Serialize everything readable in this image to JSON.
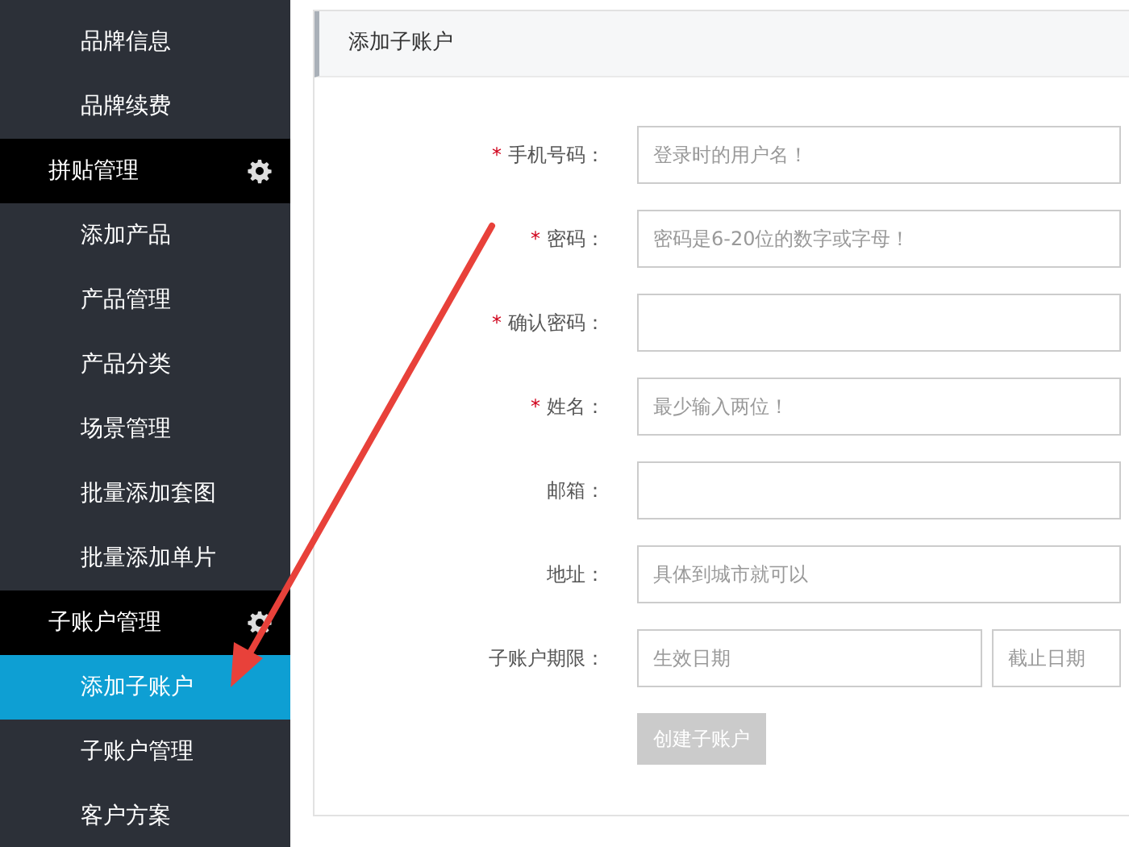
{
  "sidebar": {
    "items": [
      {
        "kind": "item",
        "label": "品牌信息",
        "selected": false
      },
      {
        "kind": "item",
        "label": "品牌续费",
        "selected": false
      },
      {
        "kind": "header",
        "label": "拼贴管理",
        "selected": false
      },
      {
        "kind": "item",
        "label": "添加产品",
        "selected": false
      },
      {
        "kind": "item",
        "label": "产品管理",
        "selected": false
      },
      {
        "kind": "item",
        "label": "产品分类",
        "selected": false
      },
      {
        "kind": "item",
        "label": "场景管理",
        "selected": false
      },
      {
        "kind": "item",
        "label": "批量添加套图",
        "selected": false
      },
      {
        "kind": "item",
        "label": "批量添加单片",
        "selected": false
      },
      {
        "kind": "header",
        "label": "子账户管理",
        "selected": false
      },
      {
        "kind": "item",
        "label": "添加子账户",
        "selected": true
      },
      {
        "kind": "item",
        "label": "子账户管理",
        "selected": false
      },
      {
        "kind": "item",
        "label": "客户方案",
        "selected": false
      }
    ]
  },
  "panel": {
    "title": "添加子账户",
    "fields": [
      {
        "kind": "text",
        "label": "手机号码：",
        "marker": "*",
        "placeholder": "登录时的用户名！"
      },
      {
        "kind": "text",
        "label": "密码：",
        "marker": "*",
        "placeholder": "密码是6-20位的数字或字母！"
      },
      {
        "kind": "text",
        "label": "确认密码：",
        "marker": "*"
      },
      {
        "kind": "text",
        "label": "姓名：",
        "marker": "*",
        "placeholder": "最少输入两位！"
      },
      {
        "kind": "text",
        "label": "邮箱："
      },
      {
        "kind": "text",
        "label": "地址：",
        "placeholder": "具体到城市就可以"
      },
      {
        "kind": "range",
        "label": "子账户期限：",
        "placeholders": [
          "生效日期",
          "截止日期"
        ]
      }
    ],
    "submit": {
      "label": "创建子账户",
      "disabled": true
    }
  }
}
